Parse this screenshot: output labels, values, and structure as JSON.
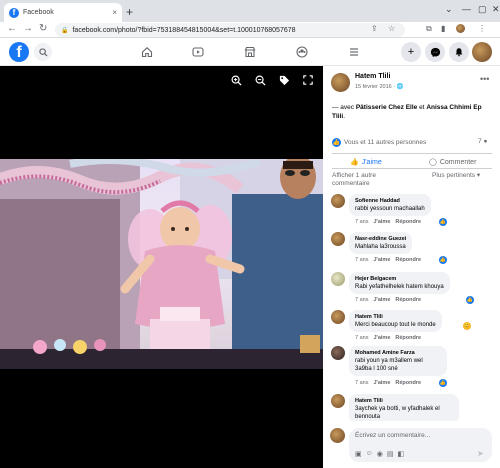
{
  "browser": {
    "tab_title": "Facebook",
    "tab_close": "×",
    "new_tab": "+",
    "url": "facebook.com/photo/?fbid=753188454815004&set=t.100010768057678"
  },
  "post": {
    "author": "Hatem Tlili",
    "date": "15 février 2016 · ",
    "caption_prefix": "— avec ",
    "tag1": "Pâtisserie Chez Elle",
    "caption_mid": " et ",
    "tag2": "Anissa Chhimi Ep Tlili",
    "caption_suffix": ".",
    "reactions": "Vous et 11 autres personnes",
    "comment_count": "7",
    "like_label": "J'aime",
    "comment_label": "Commenter",
    "prev_comments": "Afficher 1 autre commentaire",
    "sort_label": "Plus pertinents"
  },
  "comments": [
    {
      "author": "Sofienne Haddad",
      "text": "rabbi yessoun machaallah",
      "time": "7 ans",
      "like": "J'aime",
      "reply": "Répondre"
    },
    {
      "author": "Nasr-eddine Guezei",
      "text": "Mahlaha la3roussa",
      "time": "7 ans",
      "like": "J'aime",
      "reply": "Répondre"
    },
    {
      "author": "Hejer Belgacem",
      "text": "Rabi yefathelhelek hatem khouya",
      "time": "7 ans",
      "like": "J'aime",
      "reply": "Répondre"
    },
    {
      "author": "Hatem Tlili",
      "text": "Merci beaucoup tout le monde",
      "time": "7 ans",
      "like": "J'aime",
      "reply": "Répondre"
    },
    {
      "author": "Mohamed Amine Farza",
      "text": "rabi youn ya m3allem wel 3a9ba l 100 sné",
      "time": "7 ans",
      "like": "J'aime",
      "reply": "Répondre"
    },
    {
      "author": "Hatem Tlili",
      "text": "3aychek ya botti, w yfadhalek el bennouta",
      "time": "",
      "like": "",
      "reply": ""
    }
  ],
  "composer": {
    "placeholder": "Écrivez un commentaire..."
  },
  "colors": {
    "brand": "#1877f2",
    "bubble": "#f0f2f5",
    "photo_bg": "#000000"
  },
  "icons": [
    "facebook-logo-icon",
    "search-icon",
    "home-icon",
    "video-icon",
    "marketplace-icon",
    "groups-icon",
    "menu-icon",
    "plus-icon",
    "messenger-icon",
    "bell-icon",
    "zoom-in-icon",
    "zoom-out-icon",
    "tag-icon",
    "fullscreen-icon"
  ]
}
